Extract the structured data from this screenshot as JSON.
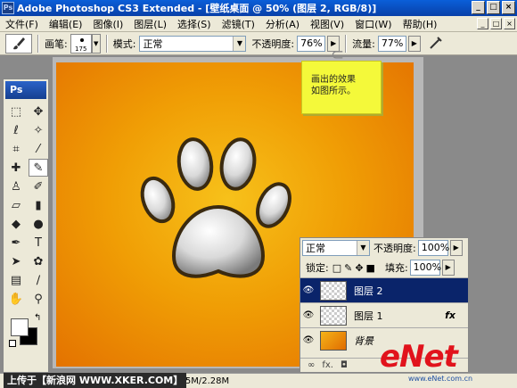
{
  "window": {
    "title": "Adobe Photoshop CS3 Extended - [壁纸桌面 @ 50% (图层 2, RGB/8)]",
    "app_icon": "Ps",
    "controls": [
      "_",
      "□",
      "×"
    ]
  },
  "menu": [
    "文件(F)",
    "编辑(E)",
    "图像(I)",
    "图层(L)",
    "选择(S)",
    "滤镜(T)",
    "分析(A)",
    "视图(V)",
    "窗口(W)",
    "帮助(H)"
  ],
  "options": {
    "brush_label": "画笔:",
    "brush_size": "175",
    "mode_label": "模式:",
    "mode_value": "正常",
    "opacity_label": "不透明度:",
    "opacity_value": "76%",
    "flow_label": "流量:",
    "flow_value": "77%"
  },
  "toolbox": {
    "logo": "Ps",
    "tools": [
      "marquee-icon",
      "move-icon",
      "lasso-icon",
      "magic-wand-icon",
      "crop-icon",
      "eyedropper-icon",
      "healing-icon",
      "brush-icon",
      "stamp-icon",
      "history-brush-icon",
      "eraser-icon",
      "gradient-icon",
      "blur-icon",
      "dodge-icon",
      "pen-icon",
      "type-icon",
      "path-select-icon",
      "shape-icon",
      "notes-icon",
      "eyedropper2-icon",
      "hand-icon",
      "zoom-icon"
    ]
  },
  "note": {
    "line1": "画出的效果",
    "line2": "如图所示。"
  },
  "layers": {
    "blend_mode": "正常",
    "opacity_label": "不透明度:",
    "opacity_value": "100%",
    "lock_label": "锁定:",
    "fill_label": "填充:",
    "fill_value": "100%",
    "items": [
      {
        "name": "图层 2",
        "selected": true,
        "fx": ""
      },
      {
        "name": "图层 1",
        "selected": false,
        "fx": "fx"
      },
      {
        "name": "背景",
        "selected": false,
        "fx": ""
      }
    ]
  },
  "status": {
    "left_text": "上传于【新浪网 WWW.XKER.COM】",
    "doc_info": "2.25M/2.28M"
  },
  "watermark": {
    "brand": "eNet",
    "sub": "www.eNet.com.cn"
  }
}
